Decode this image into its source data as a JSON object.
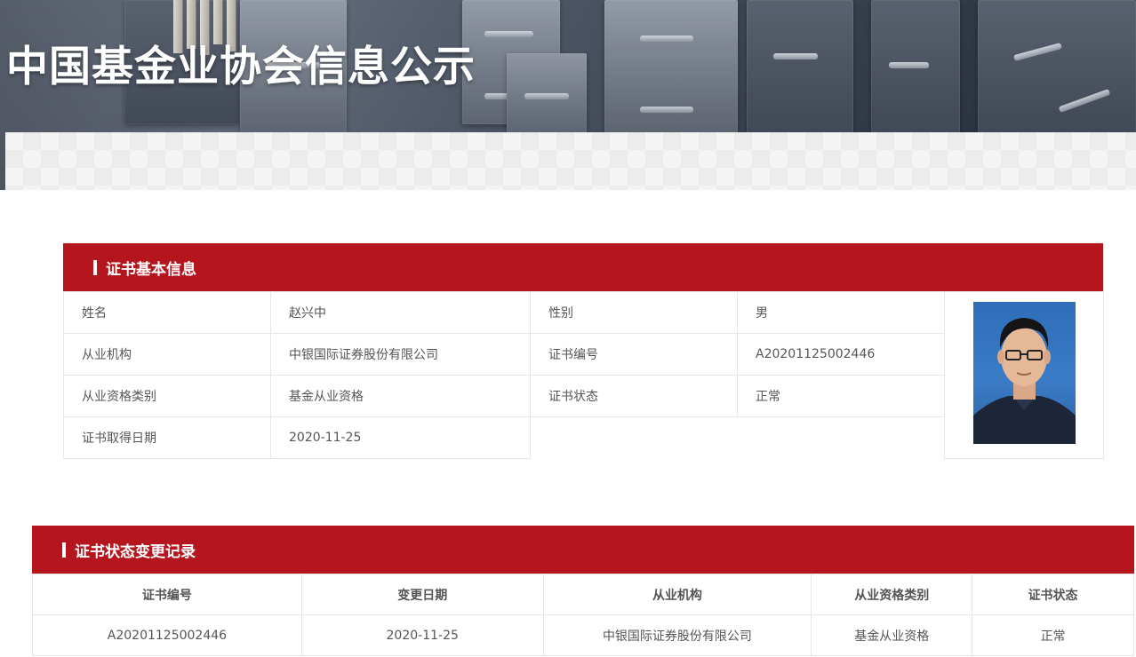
{
  "banner": {
    "title": "中国基金业协会信息公示"
  },
  "basic_info": {
    "section_title": "证书基本信息",
    "rows": [
      {
        "label1": "姓名",
        "value1": "赵兴中",
        "label2": "性别",
        "value2": "男"
      },
      {
        "label1": "从业机构",
        "value1": "中银国际证券股份有限公司",
        "label2": "证书编号",
        "value2": "A20201125002446"
      },
      {
        "label1": "从业资格类别",
        "value1": "基金从业资格",
        "label2": "证书状态",
        "value2": "正常"
      },
      {
        "label1": "证书取得日期",
        "value1": "2020-11-25"
      }
    ]
  },
  "change_record": {
    "section_title": "证书状态变更记录",
    "columns": [
      "证书编号",
      "变更日期",
      "从业机构",
      "从业资格类别",
      "证书状态"
    ],
    "rows": [
      [
        "A20201125002446",
        "2020-11-25",
        "中银国际证券股份有限公司",
        "基金从业资格",
        "正常"
      ]
    ]
  },
  "colors": {
    "accent": "#b5161e",
    "border": "#e6e6e6",
    "text": "#555555"
  }
}
